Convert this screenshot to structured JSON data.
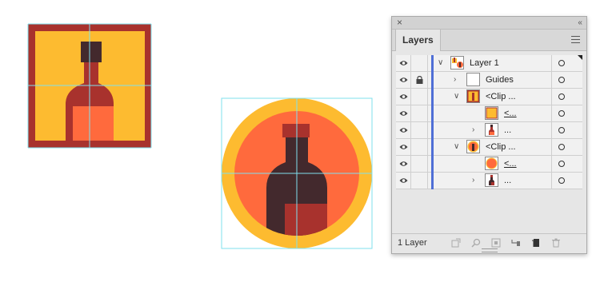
{
  "panel": {
    "close_glyph": "×",
    "collapse_glyph": "‹‹",
    "tab_label": "Layers",
    "menu_icon": "hamburger-icon",
    "footer_count": "1 Layer",
    "footer_icons": [
      "export-for-screens-icon",
      "locate-object-icon",
      "make-clipping-mask-icon",
      "create-sublayer-icon",
      "new-layer-icon",
      "delete-icon"
    ]
  },
  "layers": [
    {
      "name": "Layer 1",
      "visible": true,
      "locked": false,
      "expanded": true,
      "thumb": "layer-art"
    },
    {
      "name": "Guides",
      "visible": true,
      "locked": true,
      "expanded": false,
      "thumb": "blank"
    },
    {
      "name": "<Clip ...",
      "visible": true,
      "locked": false,
      "expanded": true,
      "thumb": "square-bottle"
    },
    {
      "name": "<...",
      "visible": true,
      "locked": false,
      "expanded": null,
      "thumb": "yellow-square"
    },
    {
      "name": "...",
      "visible": true,
      "locked": false,
      "expanded": false,
      "thumb": "bottle"
    },
    {
      "name": "<Clip ...",
      "visible": true,
      "locked": false,
      "expanded": true,
      "thumb": "circle-bottle"
    },
    {
      "name": "<...",
      "visible": true,
      "locked": false,
      "expanded": null,
      "thumb": "orange-circle"
    },
    {
      "name": "...",
      "visible": true,
      "locked": false,
      "expanded": false,
      "thumb": "bottle"
    }
  ],
  "colors": {
    "frame_red": "#a8322d",
    "yellow": "#fdbb30",
    "orange": "#ff6a3d",
    "bottle_dark": "#43292d",
    "guide_cyan": "#7fe0ee",
    "layer_blue": "#4f6fd6"
  }
}
